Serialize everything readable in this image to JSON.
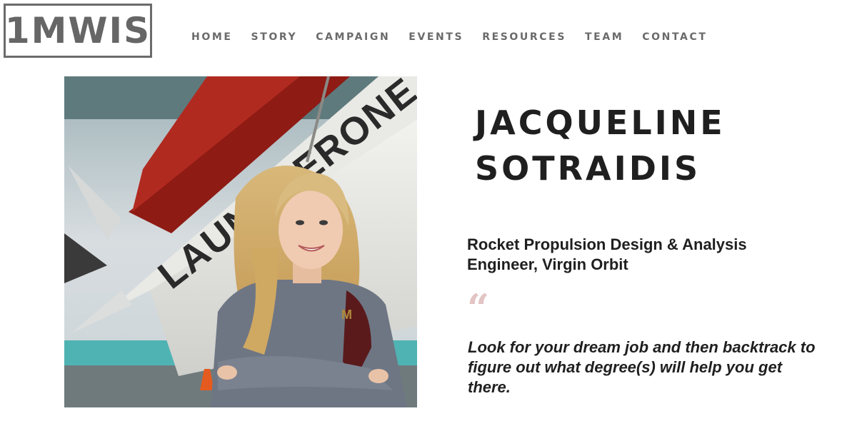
{
  "logo": {
    "text": "1MWIS"
  },
  "nav": {
    "items": [
      {
        "label": "HOME"
      },
      {
        "label": "STORY"
      },
      {
        "label": "CAMPAIGN"
      },
      {
        "label": "EVENTS"
      },
      {
        "label": "RESOURCES"
      },
      {
        "label": "TEAM"
      },
      {
        "label": "CONTACT"
      }
    ]
  },
  "profile": {
    "name_line1": "JACQUELINE",
    "name_line2": "SOTRAIDIS",
    "role_line1": "Rocket Propulsion Design & Analysis",
    "role_line2": "Engineer, Virgin Orbit",
    "quote_mark": "“",
    "quote": "Look for your dream job and then backtrack to figure out what degree(s) will help you get there.",
    "photo": {
      "rocket_text": "LAUNCHERONE"
    }
  },
  "colors": {
    "logo_border": "#6b6b6b",
    "nav_text": "#6a6a6a",
    "heading_text": "#1f1f1f",
    "quote_mark": "#e3c4c4",
    "rocket_red": "#8e1b14",
    "sweatshirt_gray": "#6e7684"
  }
}
